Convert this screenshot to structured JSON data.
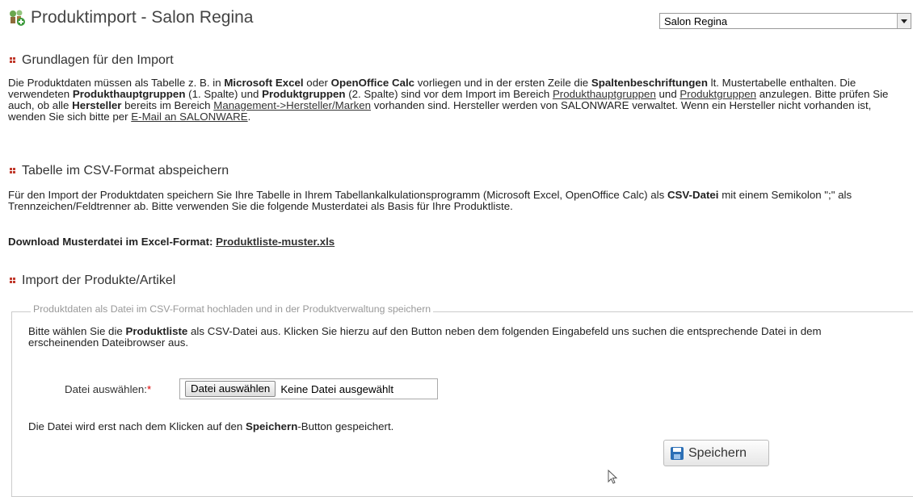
{
  "header": {
    "title": "Produktimport - Salon Regina"
  },
  "salon_select": {
    "value": "Salon Regina"
  },
  "sections": {
    "grundlagen": {
      "title": "Grundlagen für den Import",
      "p1": "Die Produktdaten müssen als Tabelle z. B. in ",
      "b1": "Microsoft Excel",
      "p2": " oder ",
      "b2": "OpenOffice Calc",
      "p3": " vorliegen und in der ersten Zeile die ",
      "b3": "Spaltenbeschriftungen",
      "p4": " lt. Mustertabelle enthalten. Die verwendeten ",
      "b4": "Produkthauptgruppen",
      "p5": " (1. Spalte) und ",
      "b5": "Produktgruppen",
      "p6": " (2. Spalte) sind vor dem Import im Bereich ",
      "link1": "Produkthauptgruppen",
      "p7": " und ",
      "link2": "Produktgruppen",
      "p8": " anzulegen. Bitte prüfen Sie auch, ob alle ",
      "b6": "Hersteller",
      "p9": " bereits im Bereich ",
      "link3": "Management->Hersteller/Marken",
      "p10": " vorhanden sind. Hersteller werden von SALONWARE verwaltet. Wenn ein Hersteller nicht vorhanden ist, wenden Sie sich bitte per ",
      "link4": "E-Mail an SALONWARE",
      "p11": "."
    },
    "csv": {
      "title": "Tabelle im CSV-Format abspeichern",
      "p1": "Für den Import der Produktdaten speichern Sie Ihre Tabelle in Ihrem Tabellankalkulationsprogramm (Microsoft Excel, OpenOffice Calc) als ",
      "b1": "CSV-Datei",
      "p2": " mit einem Semikolon \";\" als Trennzeichen/Feldtrenner ab. Bitte verwenden Sie die folgende Musterdatei als Basis für Ihre Produktliste.",
      "download_label": "Download Musterdatei im Excel-Format: ",
      "download_link": "Produktliste-muster.xls"
    },
    "import": {
      "title": "Import der Produkte/Artikel",
      "legend": "Produktdaten als Datei im CSV-Format hochladen und in der Produktverwaltung speichern",
      "p1": "Bitte wählen Sie die ",
      "b1": "Produktliste",
      "p2": " als CSV-Datei aus. Klicken Sie hierzu auf den Button neben dem folgenden Eingabefeld uns suchen die entsprechende Datei in dem erscheinenden Dateibrowser aus.",
      "file_label": "Datei auswählen:",
      "required_mark": "*",
      "file_button": "Datei auswählen",
      "file_status": "Keine Datei ausgewählt",
      "note1": "Die Datei wird erst nach dem Klicken auf den ",
      "note_b": "Speichern",
      "note2": "-Button gespeichert.",
      "save_button": "Speichern"
    }
  },
  "colors": {
    "bullet": "#c0392b",
    "save_icon": "#2c6fb5"
  },
  "icons": [
    "app-logo-icon",
    "dropdown-arrow-icon",
    "section-bullet-icon",
    "save-disk-icon",
    "mouse-cursor-icon"
  ]
}
